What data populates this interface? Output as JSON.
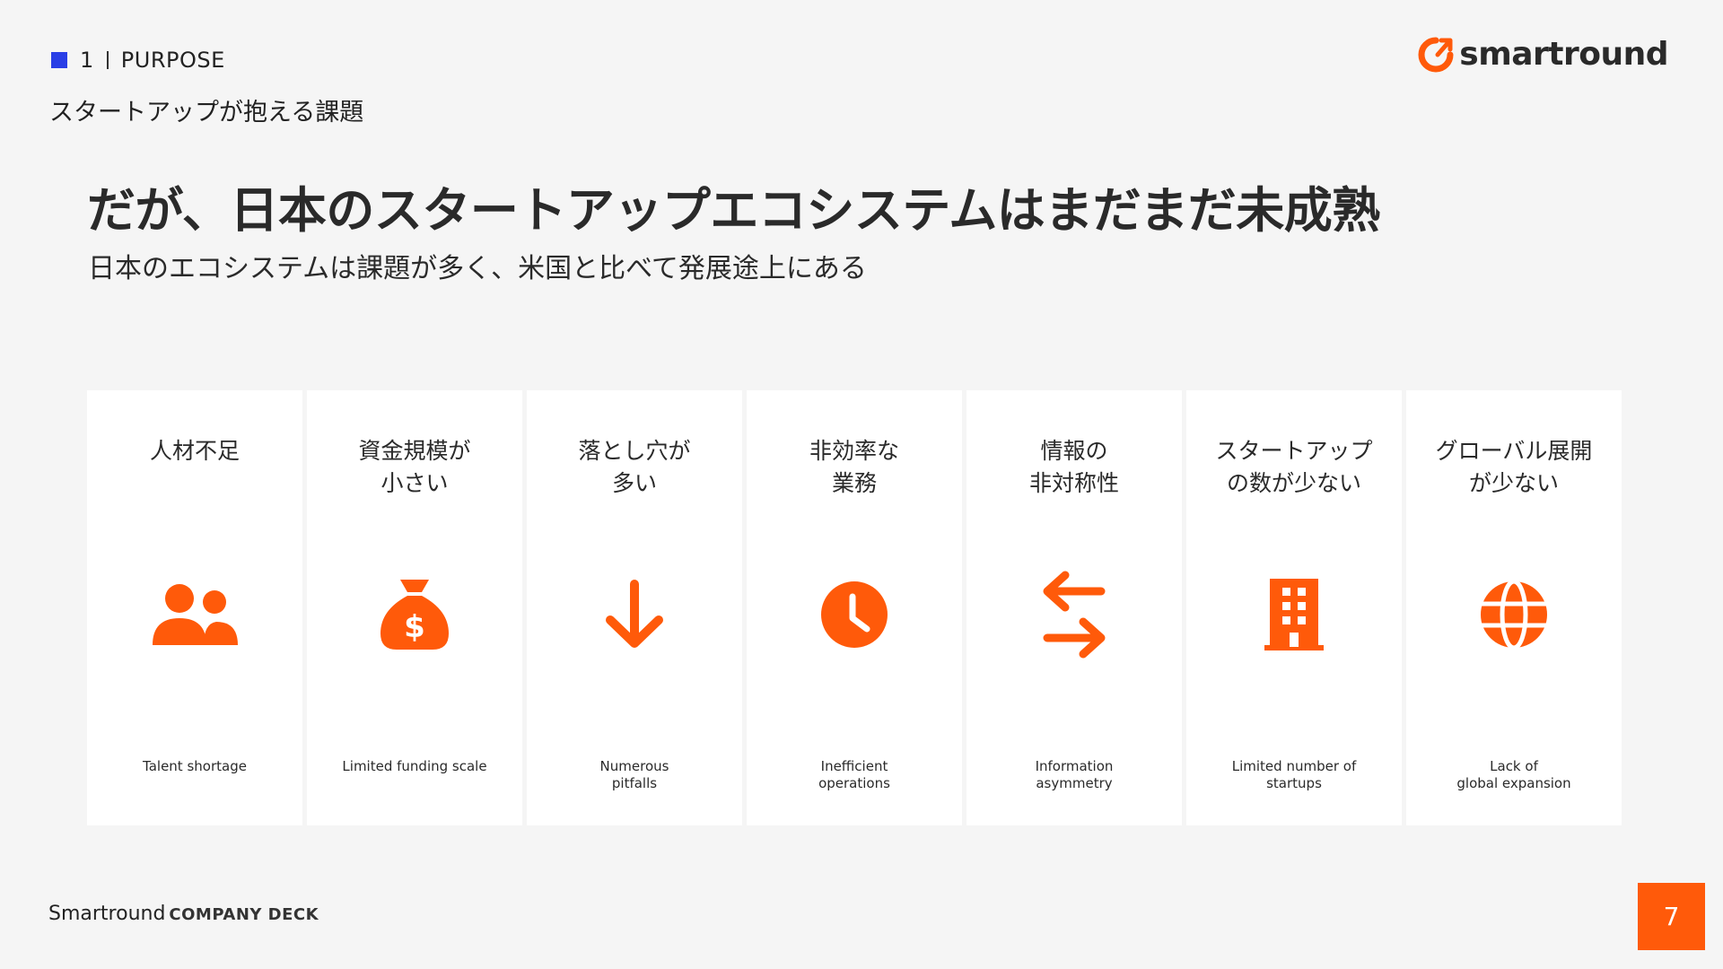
{
  "section": {
    "number": "1",
    "label": "PURPOSE",
    "subtitle": "スタートアップが抱える課題"
  },
  "brand": {
    "name": "smartround",
    "accent": "#ff5a0a",
    "marker": "#2a3fe6"
  },
  "headline": "だが、日本のスタートアップエコシステムはまだまだ未成熟",
  "subheadline": "日本のエコシステムは課題が多く、米国と比べて発展途上にある",
  "cards": [
    {
      "title": "人材不足",
      "icon": "people-icon",
      "caption": "Talent shortage"
    },
    {
      "title": "資金規模が\n小さい",
      "icon": "money-bag-icon",
      "caption": "Limited funding scale"
    },
    {
      "title": "落とし穴が\n多い",
      "icon": "arrow-down-icon",
      "caption": "Numerous\npitfalls"
    },
    {
      "title": "非効率な\n業務",
      "icon": "clock-icon",
      "caption": "Inefficient\noperations"
    },
    {
      "title": "情報の\n非対称性",
      "icon": "exchange-arrows-icon",
      "caption": "Information\nasymmetry"
    },
    {
      "title": "スタートアップ\nの数が少ない",
      "icon": "building-icon",
      "caption": "Limited number of\nstartups"
    },
    {
      "title": "グローバル展開\nが少ない",
      "icon": "globe-icon",
      "caption": "Lack of\nglobal expansion"
    }
  ],
  "footer": {
    "brand": "Smartround",
    "deck": "COMPANY DECK"
  },
  "page_number": "7"
}
